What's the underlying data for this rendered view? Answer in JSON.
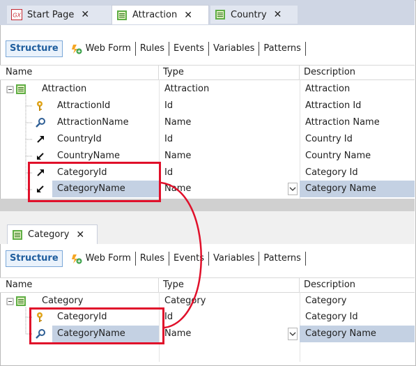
{
  "top_tabs": [
    {
      "label": "Start Page",
      "close": "✕"
    },
    {
      "label": "Attraction",
      "close": "✕"
    },
    {
      "label": "Country",
      "close": "✕"
    }
  ],
  "bottom_tab": {
    "label": "Category",
    "close": "✕"
  },
  "toolbar": {
    "structure": "Structure",
    "web_form": "Web Form",
    "rules": "Rules",
    "events": "Events",
    "variables": "Variables",
    "patterns": "Patterns"
  },
  "columns": {
    "name": "Name",
    "type": "Type",
    "description": "Description"
  },
  "attraction_grid": {
    "root": {
      "name": "Attraction",
      "type": "Attraction",
      "description": "Attraction"
    },
    "rows": [
      {
        "name": "AttractionId",
        "type": "Id",
        "description": "Attraction Id"
      },
      {
        "name": "AttractionName",
        "type": "Name",
        "description": "Attraction Name"
      },
      {
        "name": "CountryId",
        "type": "Id",
        "description": "Country Id"
      },
      {
        "name": "CountryName",
        "type": "Name",
        "description": "Country Name"
      },
      {
        "name": "CategoryId",
        "type": "Id",
        "description": "Category Id"
      },
      {
        "name": "CategoryName",
        "type": "Name",
        "description": "Category Name"
      }
    ]
  },
  "category_grid": {
    "root": {
      "name": "Category",
      "type": "Category",
      "description": "Category"
    },
    "rows": [
      {
        "name": "CategoryId",
        "type": "Id",
        "description": "Category Id"
      },
      {
        "name": "CategoryName",
        "type": "Name",
        "description": "Category Name"
      }
    ]
  },
  "colors": {
    "highlight": "#e0102a",
    "selection": "#c4d1e3",
    "structure_blue": "#1f5e9e"
  }
}
